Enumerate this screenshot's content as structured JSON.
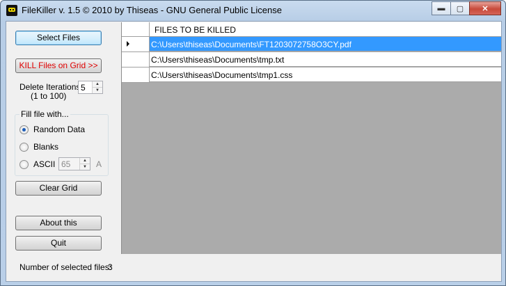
{
  "window": {
    "title": "FileKiller v. 1.5 © 2010 by Thiseas - GNU General Public License",
    "minimize_symbol": "▬",
    "maximize_symbol": "▢",
    "close_symbol": "✕"
  },
  "sidebar": {
    "select_files_label": "Select Files",
    "kill_label": "KILL Files on Grid >>",
    "delete_iterations_label_1": "Delete Iterations",
    "delete_iterations_label_2": "(1 to 100)",
    "delete_iterations_value": "5",
    "fill_group_title": "Fill file with...",
    "radio_random_label": "Random Data",
    "radio_blanks_label": "Blanks",
    "radio_ascii_label": "ASCII",
    "ascii_value": "65",
    "ascii_char": "A",
    "clear_grid_label": "Clear Grid",
    "about_label": "About this",
    "quit_label": "Quit"
  },
  "grid": {
    "column_header": "FILES TO BE KILLED",
    "rows": [
      {
        "path": "C:\\Users\\thiseas\\Documents\\FT1203072758O3CY.pdf"
      },
      {
        "path": "C:\\Users\\thiseas\\Documents\\tmp.txt"
      },
      {
        "path": "C:\\Users\\thiseas\\Documents\\tmp1.css"
      }
    ]
  },
  "status": {
    "label": "Number of selected files:",
    "count": "3"
  }
}
